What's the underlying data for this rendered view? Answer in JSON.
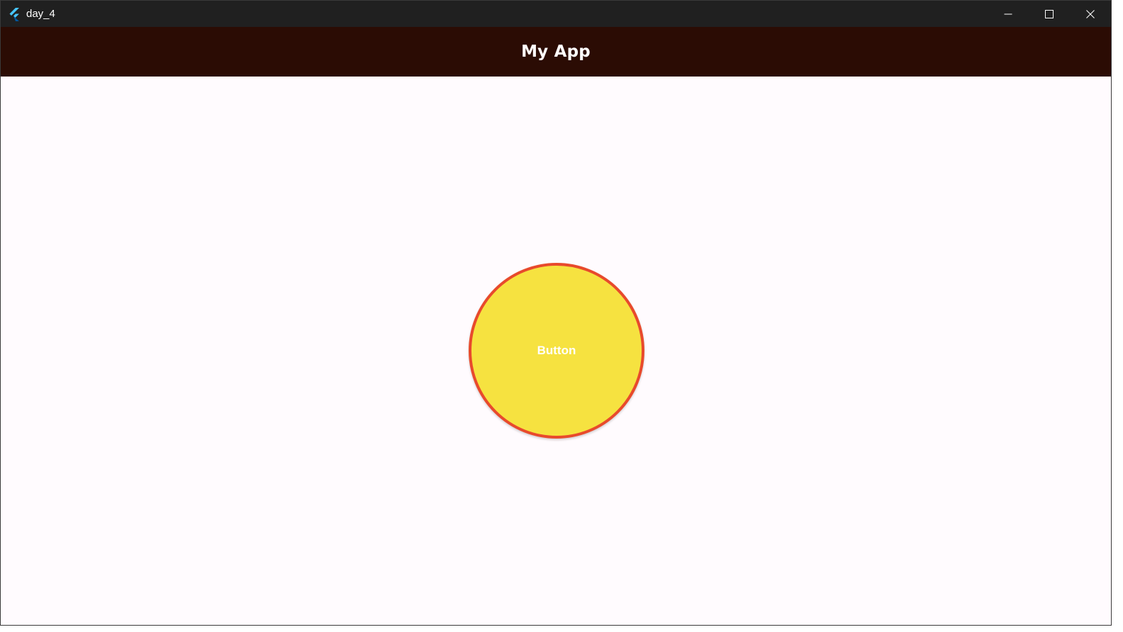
{
  "window": {
    "title": "day_4",
    "icon": "flutter-logo-icon",
    "controls": {
      "minimize_icon": "minimize-icon",
      "maximize_icon": "maximize-icon",
      "close_icon": "close-icon"
    }
  },
  "appbar": {
    "title": "My App",
    "background": "#2b0c04"
  },
  "main": {
    "button": {
      "label": "Button",
      "fill": "#f6e240",
      "border": "#e84a2c"
    }
  },
  "colors": {
    "titlebar": "#202020",
    "content_background": "#fffbfe"
  }
}
